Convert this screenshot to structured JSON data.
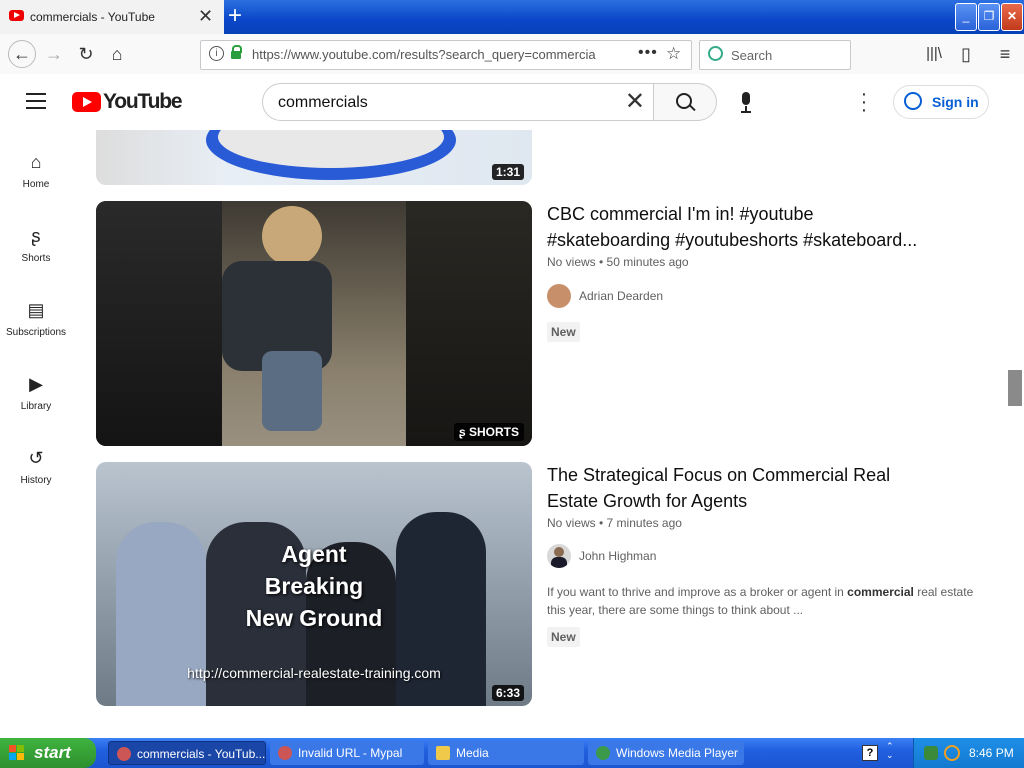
{
  "browser": {
    "tab_title": "commercials - YouTube",
    "url": "https://www.youtube.com/results?search_query=commercia",
    "search_placeholder": "Search"
  },
  "youtube": {
    "logo_text": "YouTube",
    "search_value": "commercials",
    "signin_label": "Sign in"
  },
  "sidebar": {
    "items": [
      {
        "label": "Home",
        "icon": "home-icon"
      },
      {
        "label": "Shorts",
        "icon": "shorts-icon"
      },
      {
        "label": "Subscriptions",
        "icon": "subscriptions-icon"
      },
      {
        "label": "Library",
        "icon": "library-icon"
      },
      {
        "label": "History",
        "icon": "history-icon"
      }
    ]
  },
  "results": [
    {
      "duration": "1:31"
    },
    {
      "title_line1": "CBC commercial I'm in! #youtube",
      "title_line2": "#skateboarding #youtubeshorts #skateboard...",
      "meta": "No views • 50 minutes ago",
      "channel": "Adrian Dearden",
      "badge": "New",
      "overlay_label": "SHORTS"
    },
    {
      "title_line1": "The Strategical Focus on Commercial Real",
      "title_line2": "Estate Growth for Agents",
      "meta": "No views • 7 minutes ago",
      "channel": "John Highman",
      "desc_pre": "If you want to thrive and improve as a broker or agent in ",
      "desc_bold": "commercial",
      "desc_post": " real estate",
      "desc_line2": "this year, there are some things to think about ...",
      "badge": "New",
      "thumb_line1": "Agent",
      "thumb_line2": "Breaking",
      "thumb_line3": "New Ground",
      "thumb_url": "http://commercial-realestate-training.com",
      "duration": "6:33"
    }
  ],
  "taskbar": {
    "start_label": "start",
    "tasks": [
      {
        "label": "commercials - YouTub..."
      },
      {
        "label": "Invalid URL - Mypal"
      },
      {
        "label": "Media"
      },
      {
        "label": "Windows Media Player"
      }
    ],
    "clock": "8:46 PM"
  },
  "colors": {
    "youtube_red": "#ff0000",
    "link_blue": "#065fd4",
    "xp_taskbar": "#245edb",
    "xp_start_green": "#3c9a3c"
  }
}
